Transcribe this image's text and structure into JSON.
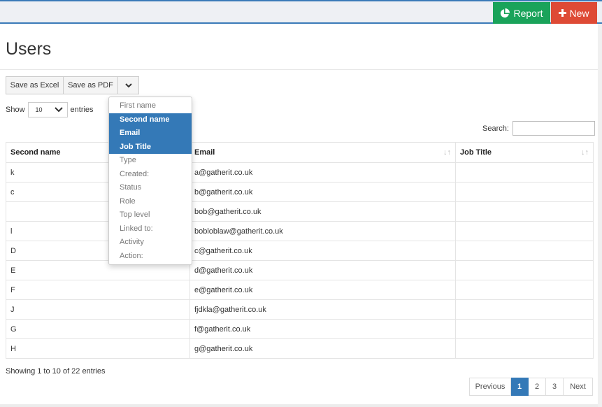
{
  "header": {
    "report_label": "Report",
    "report_icon": "pie-chart-icon",
    "new_label": "New",
    "new_icon": "plus-icon",
    "report_color": "#1aa35a",
    "new_color": "#de4a35"
  },
  "page": {
    "title": "Users"
  },
  "toolbar": {
    "excel_label": "Save as Excel",
    "pdf_label": "Save as PDF",
    "dropdown_icon": "chevron-down-icon"
  },
  "length": {
    "show_label": "Show",
    "value": "10",
    "entries_label": "entries"
  },
  "search": {
    "label": "Search:",
    "value": ""
  },
  "column_menu": {
    "items": [
      {
        "label": "First name",
        "active": false
      },
      {
        "label": "Second name",
        "active": true
      },
      {
        "label": "Email",
        "active": true
      },
      {
        "label": "Job Title",
        "active": true
      },
      {
        "label": "Type",
        "active": false
      },
      {
        "label": "Created:",
        "active": false
      },
      {
        "label": "Status",
        "active": false
      },
      {
        "label": "Role",
        "active": false
      },
      {
        "label": "Top level",
        "active": false
      },
      {
        "label": "Linked to:",
        "active": false
      },
      {
        "label": "Activity",
        "active": false
      },
      {
        "label": "Action:",
        "active": false
      }
    ],
    "active_color": "#3479b7"
  },
  "table": {
    "columns": [
      "Second name",
      "Email",
      "Job Title"
    ],
    "rows": [
      [
        "k",
        "a@gatherit.co.uk",
        ""
      ],
      [
        "c",
        "b@gatherit.co.uk",
        ""
      ],
      [
        "",
        "bob@gatherit.co.uk",
        ""
      ],
      [
        "l",
        "bobloblaw@gatherit.co.uk",
        ""
      ],
      [
        "D",
        "c@gatherit.co.uk",
        ""
      ],
      [
        "E",
        "d@gatherit.co.uk",
        ""
      ],
      [
        "F",
        "e@gatherit.co.uk",
        ""
      ],
      [
        "J",
        "fjdkla@gatherit.co.uk",
        ""
      ],
      [
        "G",
        "f@gatherit.co.uk",
        ""
      ],
      [
        "H",
        "g@gatherit.co.uk",
        ""
      ]
    ]
  },
  "footer": {
    "info": "Showing 1 to 10 of 22 entries",
    "pagination": {
      "previous": "Previous",
      "pages": [
        "1",
        "2",
        "3"
      ],
      "current": "1",
      "next": "Next"
    }
  }
}
